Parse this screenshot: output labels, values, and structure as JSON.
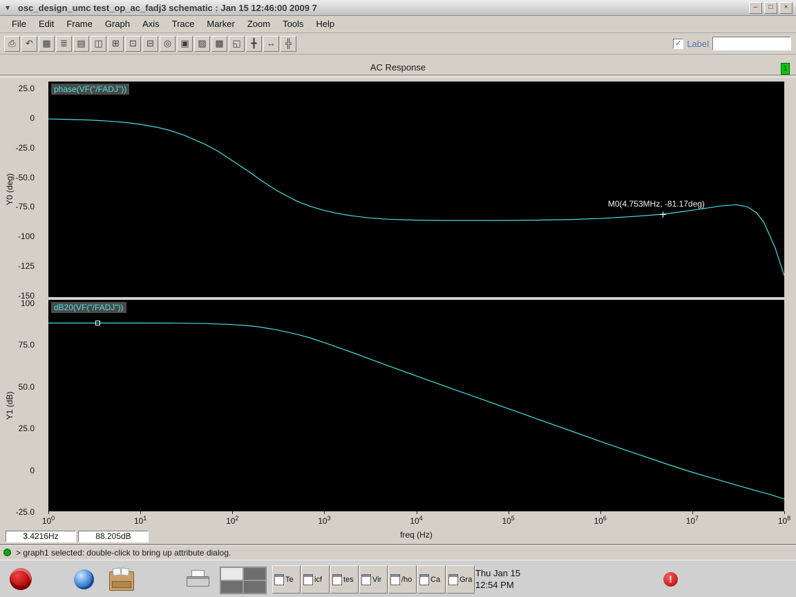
{
  "titlebar": {
    "title": "osc_design_umc test_op_ac_fadj3 schematic : Jan 15 12:46:00 2009 7",
    "minimize": "–",
    "maximize": "□",
    "close": "×"
  },
  "menu": {
    "items": [
      "File",
      "Edit",
      "Frame",
      "Graph",
      "Axis",
      "Trace",
      "Marker",
      "Zoom",
      "Tools",
      "Help"
    ]
  },
  "toolbar": {
    "icons": [
      {
        "name": "print-icon",
        "glyph": "⎙"
      },
      {
        "name": "undo-icon",
        "glyph": "↶"
      },
      {
        "name": "grid-toggle-icon",
        "glyph": "▦"
      },
      {
        "name": "strip-mode-icon",
        "glyph": "≣"
      },
      {
        "name": "overlay-mode-icon",
        "glyph": "▤"
      },
      {
        "name": "subwindow-icon",
        "glyph": "◫"
      },
      {
        "name": "new-graph-icon",
        "glyph": "⊞"
      },
      {
        "name": "copy-graph-icon",
        "glyph": "⊡"
      },
      {
        "name": "delete-trace-icon",
        "glyph": "⊟"
      },
      {
        "name": "trace-cursor-icon",
        "glyph": "◎"
      },
      {
        "name": "freeze-icon",
        "glyph": "▣"
      },
      {
        "name": "shaded-graph-icon",
        "glyph": "▨"
      },
      {
        "name": "dark-graph-icon",
        "glyph": "▩"
      },
      {
        "name": "zoom-fit-icon",
        "glyph": "◱"
      },
      {
        "name": "pan-icon",
        "glyph": "╋"
      },
      {
        "name": "zoom-x-icon",
        "glyph": "↔"
      },
      {
        "name": "zoom-xy-icon",
        "glyph": "╬"
      }
    ],
    "label_checkbox": "Label",
    "label_checked": true,
    "label_value": ""
  },
  "graph": {
    "title": "AC Response",
    "page": "1",
    "x_readout": "3.4216Hz",
    "y_readout": "88.205dB",
    "marker": {
      "label": "M0(4.753MHz, -81.17deg)",
      "freq": 4753000,
      "value": -81.17
    }
  },
  "xaxis": {
    "label": "freq (Hz)",
    "scale": "log",
    "exponents": [
      0,
      1,
      2,
      3,
      4,
      5,
      6,
      7,
      8
    ]
  },
  "chart_data": [
    {
      "type": "line",
      "label": "phase(VF(\"/FADJ\"))",
      "ylabel": "Y0 (deg)",
      "color": "#49e0e0",
      "xlim": [
        1,
        100000000.0
      ],
      "ylim": [
        -150,
        25
      ],
      "yticks": [
        25,
        0,
        -25,
        -50,
        -75,
        -100,
        -125,
        -150
      ],
      "ytick_labels": [
        "25.0",
        "0",
        "-25.0",
        "-50.0",
        "-75.0",
        "-100",
        "-125",
        "-150"
      ],
      "x": [
        1,
        1.5,
        2,
        3,
        5,
        7,
        10,
        15,
        20,
        30,
        50,
        70,
        100,
        150,
        200,
        300,
        500,
        700,
        1000,
        1500,
        2000,
        3000,
        5000,
        10000.0,
        20000.0,
        50000.0,
        100000.0,
        200000.0,
        500000.0,
        1000000.0,
        2000000.0,
        3000000.0,
        4753000.0,
        7000000.0,
        10000000.0,
        15000000.0,
        20000000.0,
        30000000.0,
        40000000.0,
        50000000.0,
        60000000.0,
        80000000.0,
        100000000.0
      ],
      "y": [
        -0.8,
        -1.0,
        -1.3,
        -1.8,
        -2.8,
        -3.8,
        -5.3,
        -7.7,
        -10,
        -14.5,
        -22,
        -28,
        -36,
        -45,
        -52,
        -61,
        -70,
        -74.5,
        -78,
        -81,
        -82.5,
        -84.2,
        -85.4,
        -86.2,
        -86.5,
        -86.5,
        -86.4,
        -86.2,
        -85.6,
        -84.8,
        -83.4,
        -82.4,
        -81.17,
        -79.5,
        -77.8,
        -75.8,
        -74.3,
        -73.2,
        -75,
        -80,
        -88,
        -110,
        -133
      ]
    },
    {
      "type": "line",
      "label": "dB20(VF(\"/FADJ\"))",
      "ylabel": "Y1 (dB)",
      "color": "#49e0e0",
      "xlim": [
        1,
        100000000.0
      ],
      "ylim": [
        -25,
        100
      ],
      "yticks": [
        100,
        75,
        50,
        25,
        0,
        -25
      ],
      "ytick_labels": [
        "100",
        "75.0",
        "50.0",
        "25.0",
        "0",
        "-25.0"
      ],
      "point_marker": {
        "x": 3.4216,
        "y": 88.205
      },
      "x": [
        1,
        2,
        3.4216,
        5,
        10,
        20,
        30,
        50,
        100,
        150,
        200,
        300,
        500,
        700,
        1000,
        2000,
        3000,
        5000,
        10000.0,
        20000.0,
        50000.0,
        100000.0,
        200000.0,
        500000.0,
        1000000.0,
        2000000.0,
        5000000.0,
        7000000.0,
        10000000.0,
        20000000.0,
        30000000.0,
        50000000.0,
        70000000.0,
        100000000.0
      ],
      "y": [
        88.21,
        88.21,
        88.205,
        88.2,
        88.19,
        88.15,
        88.1,
        87.9,
        87.3,
        86.6,
        85.8,
        84.2,
        81.5,
        79.3,
        76.5,
        70.6,
        67,
        62.5,
        56.5,
        50.6,
        42.8,
        36.9,
        31,
        23.2,
        17.3,
        11.6,
        4.2,
        1.5,
        -1.2,
        -6,
        -8.8,
        -12.3,
        -14.5,
        -17.2
      ]
    }
  ],
  "statusbar": {
    "text": "> graph1 selected: double-click to bring up attribute dialog."
  },
  "taskbar": {
    "tasks": [
      "Te",
      "icf",
      "tes",
      "Vir",
      "/ho",
      "Ca",
      "Gra"
    ],
    "clock_date": "Thu Jan 15",
    "clock_time": "12:54 PM"
  }
}
